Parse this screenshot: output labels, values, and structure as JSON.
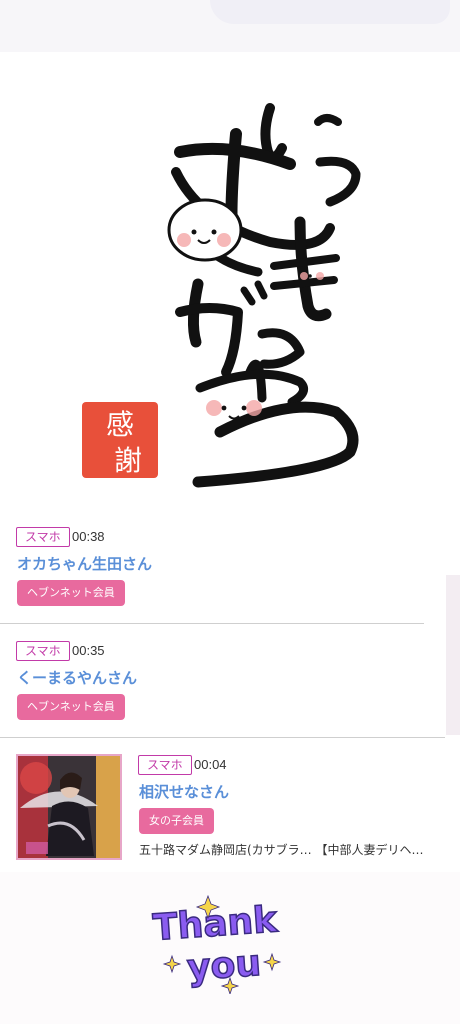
{
  "art": {
    "stamp_text": "感謝"
  },
  "visits": [
    {
      "device": "スマホ",
      "time": "00:38",
      "name": "オカちゃん生田さん",
      "badge": "ヘブンネット会員"
    },
    {
      "device": "スマホ",
      "time": "00:35",
      "name": "くーまるやんさん",
      "badge": "ヘブンネット会員"
    },
    {
      "device": "スマホ",
      "time": "00:04",
      "name": "相沢せなさん",
      "badge": "女の子会員",
      "shop": "五十路マダム静岡店(カサブラ… 【中部人妻デリヘ…"
    }
  ],
  "thank_you": {
    "line1": "Thank",
    "line2": "you"
  },
  "colors": {
    "tag_border": "#c23aa8",
    "name": "#5a8fd8",
    "badge_bg": "#e86a9e",
    "stamp": "#e8503a"
  }
}
